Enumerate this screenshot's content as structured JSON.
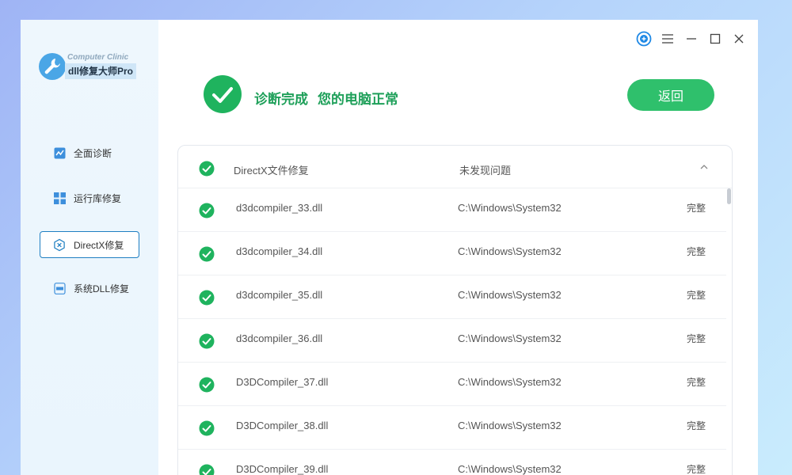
{
  "app": {
    "logo_subtitle": "Computer Clinic",
    "logo_title": "dll修复大师Pro"
  },
  "sidebar": {
    "items": [
      {
        "label": "全面诊断",
        "icon": "chart-icon",
        "active": false
      },
      {
        "label": "运行库修复",
        "icon": "grid-icon",
        "active": false
      },
      {
        "label": "DirectX修复",
        "icon": "directx-icon",
        "active": true
      },
      {
        "label": "系统DLL修复",
        "icon": "dll-file-icon",
        "active": false
      }
    ]
  },
  "status": {
    "title": "诊断完成",
    "message": "您的电脑正常",
    "back_label": "返回"
  },
  "panel": {
    "name": "DirectX文件修复",
    "status": "未发现问题",
    "rows": [
      {
        "file": "d3dcompiler_33.dll",
        "path": "C:\\Windows\\System32",
        "state": "完整"
      },
      {
        "file": "d3dcompiler_34.dll",
        "path": "C:\\Windows\\System32",
        "state": "完整"
      },
      {
        "file": "d3dcompiler_35.dll",
        "path": "C:\\Windows\\System32",
        "state": "完整"
      },
      {
        "file": "d3dcompiler_36.dll",
        "path": "C:\\Windows\\System32",
        "state": "完整"
      },
      {
        "file": "D3DCompiler_37.dll",
        "path": "C:\\Windows\\System32",
        "state": "完整"
      },
      {
        "file": "D3DCompiler_38.dll",
        "path": "C:\\Windows\\System32",
        "state": "完整"
      },
      {
        "file": "D3DCompiler_39.dll",
        "path": "C:\\Windows\\System32",
        "state": "完整"
      }
    ]
  },
  "colors": {
    "accent_green": "#2fc06c",
    "active_border": "#1f7fc2",
    "support_blue": "#1e88e5"
  }
}
